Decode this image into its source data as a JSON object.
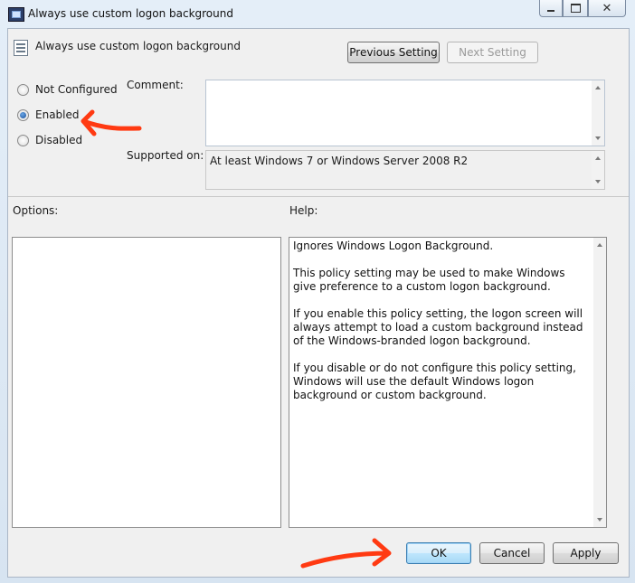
{
  "window": {
    "title": "Always use custom logon background",
    "icon": "policy-window-icon"
  },
  "header": {
    "title": "Always use custom logon background",
    "previous_label": "Previous Setting",
    "next_label": "Next Setting"
  },
  "state": {
    "options": [
      {
        "label": "Not Configured",
        "checked": false
      },
      {
        "label": "Enabled",
        "checked": true
      },
      {
        "label": "Disabled",
        "checked": false
      }
    ]
  },
  "comment": {
    "label": "Comment:",
    "value": ""
  },
  "supported": {
    "label": "Supported on:",
    "value": "At least Windows 7 or Windows Server 2008 R2"
  },
  "options_panel": {
    "label": "Options:"
  },
  "help_panel": {
    "label": "Help:",
    "paragraphs": [
      "Ignores Windows Logon Background.",
      "This policy setting may be used to make Windows give preference to a custom logon background.",
      "If you enable this policy setting, the logon screen will always attempt to load a custom background instead of the Windows-branded logon background.",
      "If you disable or do not configure this policy setting, Windows will use the default Windows logon background or custom background."
    ]
  },
  "footer": {
    "ok_label": "OK",
    "cancel_label": "Cancel",
    "apply_label": "Apply"
  },
  "annotations": {
    "color": "#ff3a12"
  }
}
